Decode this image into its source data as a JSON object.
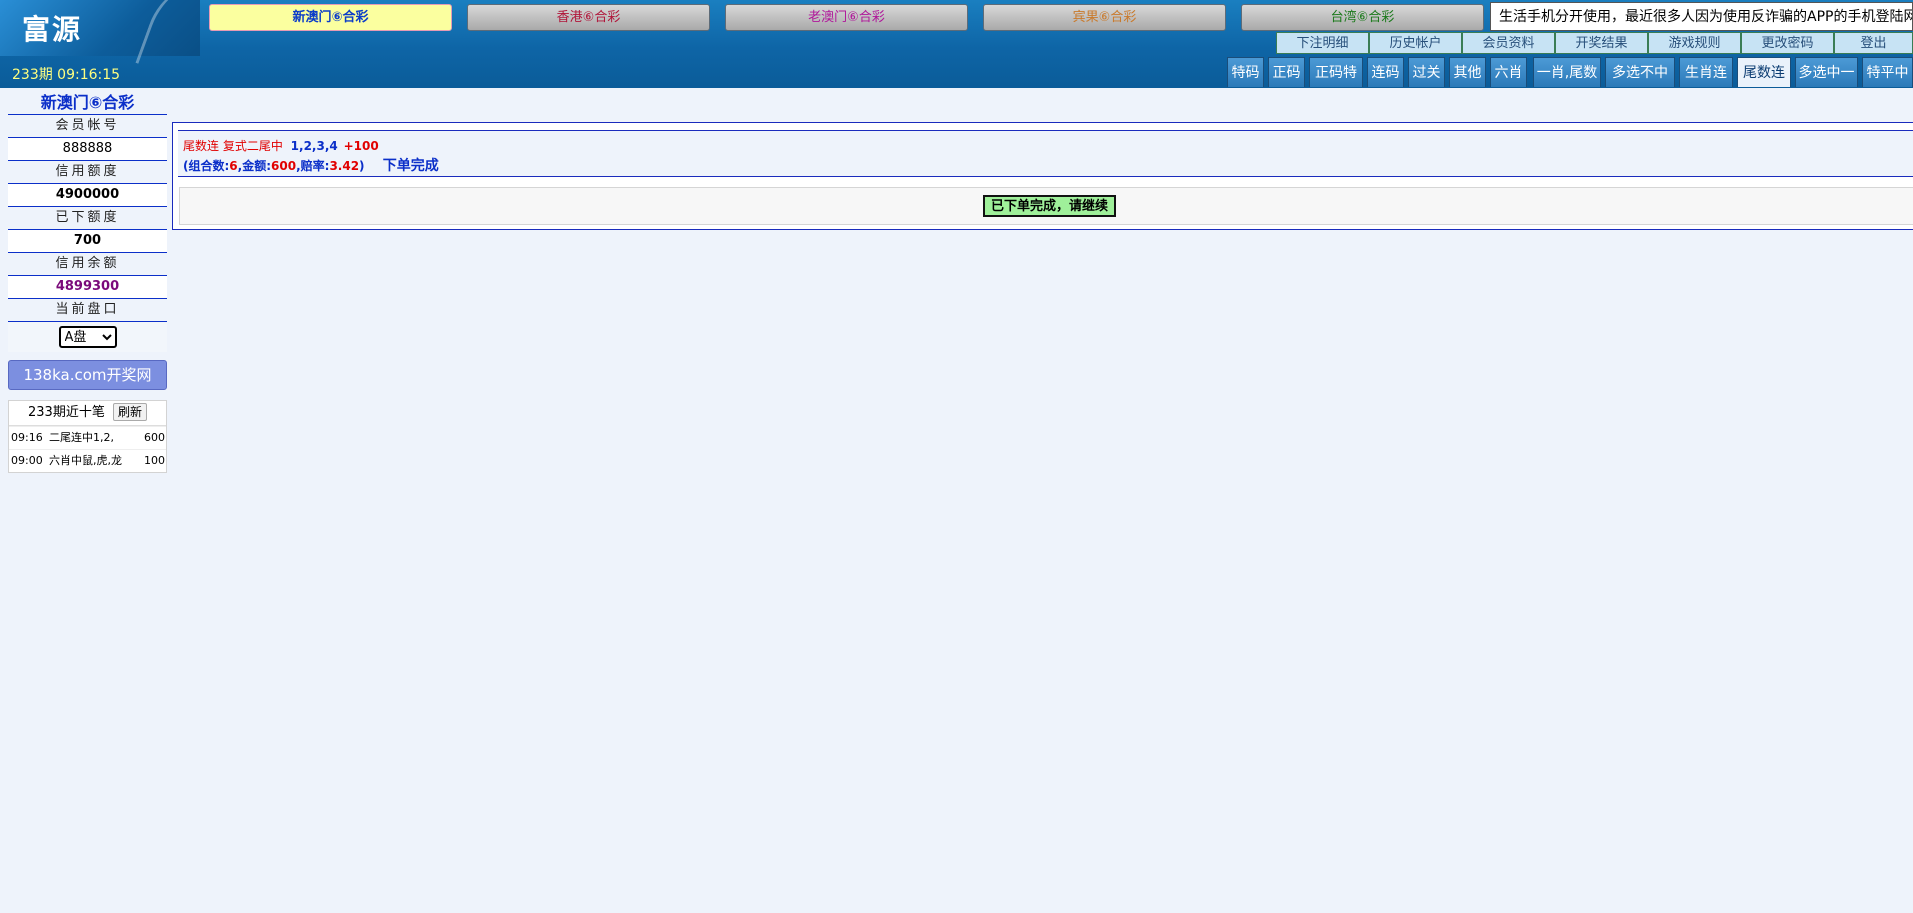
{
  "header": {
    "logo": "富源",
    "lottery_tabs": [
      "新澳门⑥合彩",
      "香港⑥合彩",
      "老澳门⑥合彩",
      "宾果⑥合彩",
      "台湾⑥合彩"
    ],
    "lottery_tab_colors": [
      "#0b3cc9",
      "#b0163a",
      "#b0169a",
      "#c97a2c",
      "#1b7a1b"
    ],
    "marquee": "生活手机分开使用，最近很多人因为使用反诈骗的APP的手机登陆网",
    "sub_links": [
      "下注明细",
      "历史帐户",
      "会员资料",
      "开奖结果",
      "游戏规则",
      "更改密码",
      "登出"
    ],
    "period_time": "233期 09:16:15",
    "game_tabs": [
      "特码",
      "正码",
      "正码特",
      "连码",
      "过关",
      "其他",
      "六肖",
      "一肖,尾数",
      "多选不中",
      "生肖连",
      "尾数连",
      "多选中一",
      "特平中"
    ],
    "active_game_tab": "尾数连"
  },
  "sidebar": {
    "title": "新澳门⑥合彩",
    "account_label": "会员帐号",
    "account_value": "888888",
    "credit_label": "信用额度",
    "credit_value": "4900000",
    "placed_label": "已下额度",
    "placed_value": "700",
    "balance_label": "信用余额",
    "balance_value": "4899300",
    "plate_label": "当前盘口",
    "plate_value": "A盘",
    "kj_button": "138ka.com开奖网",
    "recent_title": "233期近十笔",
    "refresh": "刷新",
    "recent": [
      {
        "time": "09:16",
        "desc": "二尾连中1,2,",
        "amount": "600"
      },
      {
        "time": "09:00",
        "desc": "六肖中鼠,虎,龙",
        "amount": "100"
      }
    ]
  },
  "main": {
    "bet_type": "尾数连 复式二尾中",
    "numbers": "1,2,3,4",
    "amount": "+100",
    "combo_label": "(组合数:",
    "combo_value": "6",
    "money_label": ",金额:",
    "money_value": "600",
    "odds_label": ",赔率:",
    "odds_value": "3.42",
    "close_paren": ")",
    "done": "下单完成",
    "continue": "已下单完成，请继续"
  }
}
